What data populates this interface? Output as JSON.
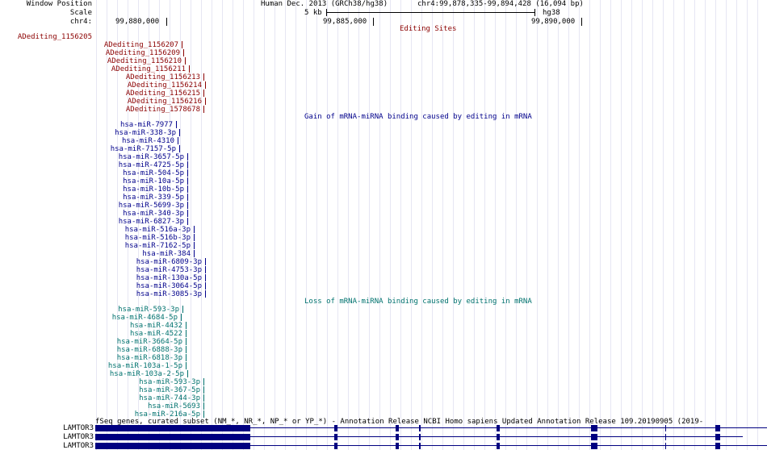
{
  "header": {
    "window_position_label": "Window Position",
    "scale_label": "Scale",
    "chrom_label": "chr4:",
    "assembly": "Human Dec. 2013 (GRCh38/hg38)",
    "position": "chr4:99,878,335-99,894,428 (16,094 bp)",
    "scale_text": "5 kb",
    "db": "hg38",
    "coords": [
      "99,880,000",
      "99,885,000",
      "99,890,000"
    ]
  },
  "colors": {
    "editing": "#8b0000",
    "gain": "#00008b",
    "loss": "#00726e",
    "gene": "#000080",
    "grid": "#e6e6f3"
  },
  "tracks": {
    "editing": {
      "title": "Editing Sites",
      "left_label": "ADediting_1156205",
      "items": [
        "ADediting_1156207",
        "ADediting_1156209",
        "ADediting_1156210",
        "ADediting_1156211",
        "ADediting_1156213",
        "ADediting_1156214",
        "ADediting_1156215",
        "ADediting_1156216",
        "ADediting_1578678"
      ]
    },
    "gain": {
      "title": "Gain of mRNA-miRNA binding caused by editing in mRNA",
      "items": [
        "hsa-miR-7977",
        "hsa-miR-338-3p",
        "hsa-miR-4310",
        "hsa-miR-7157-5p",
        "hsa-miR-3657-5p",
        "hsa-miR-4725-5p",
        "hsa-miR-504-5p",
        "hsa-miR-10a-5p",
        "hsa-miR-10b-5p",
        "hsa-miR-339-5p",
        "hsa-miR-5699-3p",
        "hsa-miR-340-3p",
        "hsa-miR-6827-3p",
        "hsa-miR-516a-3p",
        "hsa-miR-516b-3p",
        "hsa-miR-7162-5p",
        "hsa-miR-384",
        "hsa-miR-6809-3p",
        "hsa-miR-4753-3p",
        "hsa-miR-130a-5p",
        "hsa-miR-3064-5p",
        "hsa-miR-3085-3p"
      ]
    },
    "loss": {
      "title": "Loss of mRNA-miRNA binding caused by editing in mRNA",
      "items": [
        "hsa-miR-593-3p",
        "hsa-miR-4684-5p",
        "hsa-miR-4432",
        "hsa-miR-4522",
        "hsa-miR-3664-5p",
        "hsa-miR-6888-3p",
        "hsa-miR-6818-3p",
        "hsa-miR-103a-1-5p",
        "hsa-miR-103a-2-5p",
        "hsa-miR-593-3p",
        "hsa-miR-367-5p",
        "hsa-miR-744-3p",
        "hsa-miR-5693",
        "hsa-miR-216a-5p"
      ]
    },
    "genes": {
      "title": "fSeq genes, curated subset (NM_*, NR_*, NP_* or YP_*) - Annotation Release NCBI Homo sapiens Updated Annotation Release 109.20190905 (2019-",
      "rows": [
        "LAMTOR3",
        "LAMTOR3",
        "LAMTOR3"
      ]
    }
  }
}
